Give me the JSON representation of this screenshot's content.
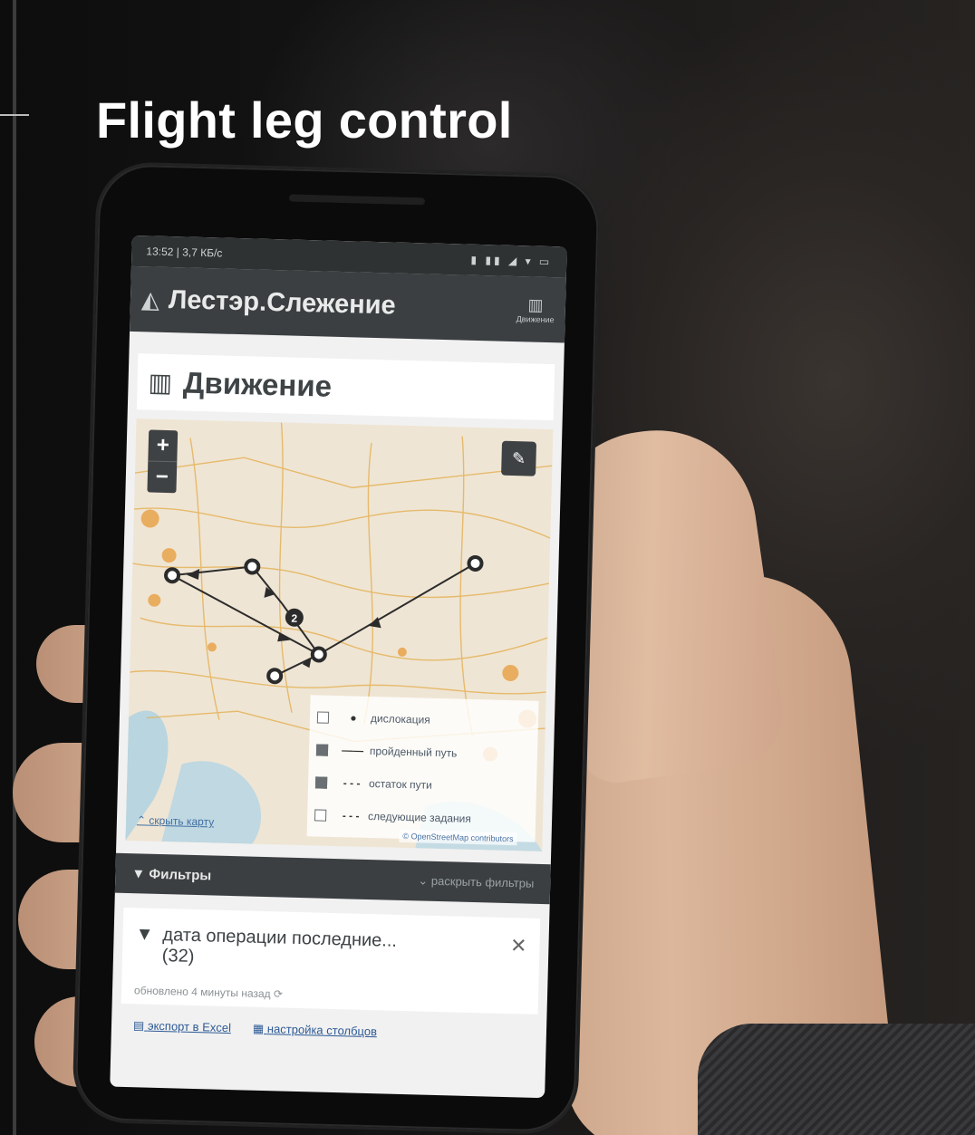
{
  "headline": "Flight leg control",
  "phone": {
    "status_left": "13:52 | 3,7 КБ/с",
    "status_right": "▮ ▮▮ ◢ ▾ ▭",
    "app_title": "Лестэр.Слежение",
    "app_logo_icon": "triangle-logo-icon",
    "nav_movement_label": "Движение",
    "section_title": "Движение",
    "map": {
      "zoom_in": "+",
      "zoom_out": "−",
      "edit_glyph": "✎",
      "legend": [
        {
          "checked": false,
          "symbol": "●",
          "label": "дислокация"
        },
        {
          "checked": true,
          "symbol": "——",
          "label": "пройденный путь"
        },
        {
          "checked": true,
          "symbol": "- - -",
          "label": "остаток пути"
        },
        {
          "checked": false,
          "symbol": "- - -",
          "label": "следующие задания"
        }
      ],
      "hide_map": "скрыть карту",
      "attribution": "© OpenStreetMap contributors",
      "waypoint_badge": "2"
    },
    "filters": {
      "title": "Фильтры",
      "expand": "раскрыть фильтры"
    },
    "filter_chip": {
      "text": "дата операции последние...",
      "count": "(32)",
      "updated": "обновлено 4 минуты назад"
    },
    "links": {
      "export": "экспорт в Excel",
      "columns": "настройка столбцов"
    }
  },
  "colors": {
    "appbar": "#3b3f41",
    "map_bg": "#efe5d4",
    "route": "#2b2b2b"
  }
}
